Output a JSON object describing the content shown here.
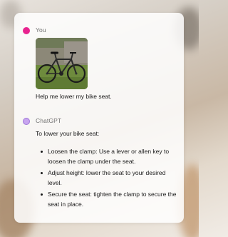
{
  "conversation": {
    "user": {
      "name": "You",
      "avatar_color": "#e8238f",
      "image_description_icon": "bike-photo",
      "message": "Help me lower my bike seat."
    },
    "assistant": {
      "name": "ChatGPT",
      "avatar_color": "#c8a5ef",
      "intro": "To lower your bike seat:",
      "steps": [
        "Loosen the clamp: Use a lever or allen key to loosen the clamp under the seat.",
        "Adjust height: lower the seat to your desired level.",
        "Secure the seat: tighten the clamp to secure the seat in place."
      ]
    }
  }
}
